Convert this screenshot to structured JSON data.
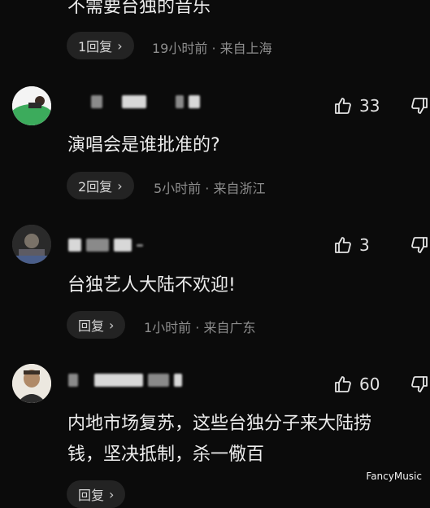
{
  "top_comment": {
    "text": "不需要台独的音乐",
    "reply_label": "1回复",
    "meta": "19小时前 · 来自上海"
  },
  "comments": [
    {
      "likes": "33",
      "text": "演唱会是谁批准的?",
      "reply_label": "2回复",
      "meta": "5小时前 · 来自浙江"
    },
    {
      "likes": "3",
      "text": "台独艺人大陆不欢迎!",
      "reply_label": "回复",
      "meta": "1小时前 · 来自广东"
    },
    {
      "likes": "60",
      "text_line1": "内地市场复苏，这些台独分子来大陆捞",
      "text_line2": "钱，坚决抵制，杀一儆百",
      "reply_label": "回复"
    }
  ],
  "watermark": "FancyMusic",
  "icons": {
    "like": "thumbs-up-icon",
    "dislike": "thumbs-down-icon",
    "reply_chevron": "chevron-right-icon"
  }
}
